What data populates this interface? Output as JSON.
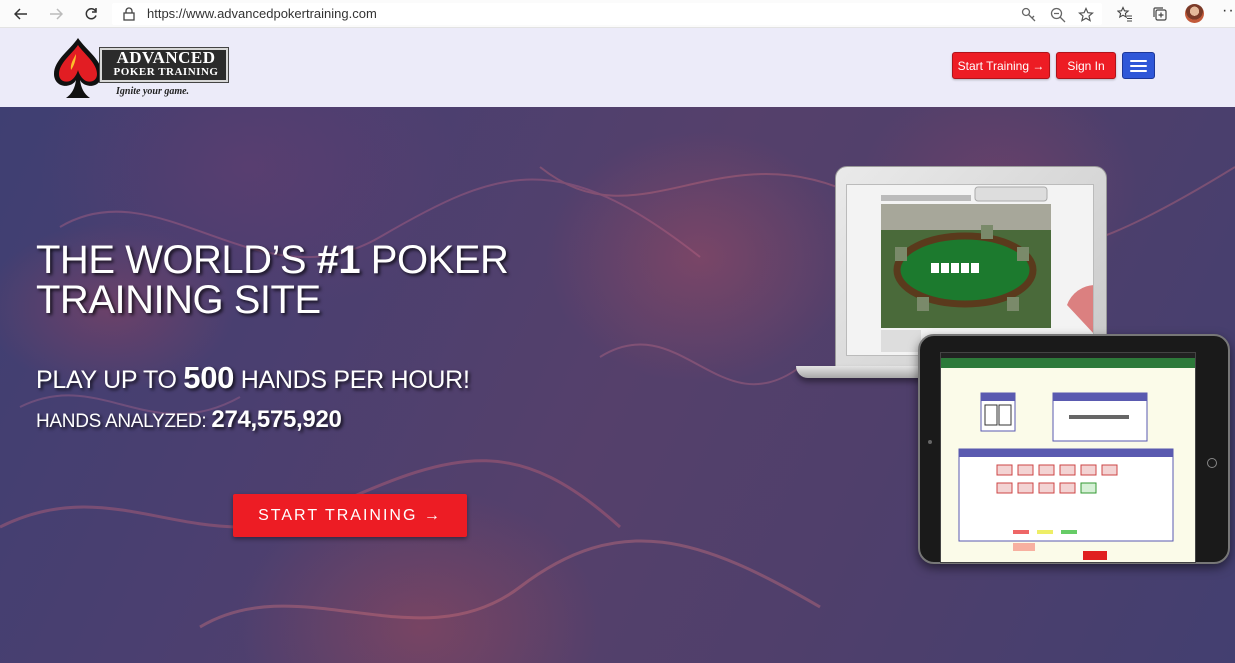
{
  "browser": {
    "url": "https://www.advancedpokertraining.com",
    "icons": [
      "back-icon",
      "forward-icon",
      "refresh-icon",
      "lock-icon",
      "key-icon",
      "zoom-icon",
      "star-icon",
      "favorites-icon",
      "collections-icon",
      "profile-avatar",
      "more-icon"
    ]
  },
  "header": {
    "logo_line1": "ADVANCED",
    "logo_line2": "POKER TRAINING",
    "logo_tagline": "Ignite your game.",
    "start_training_label": "Start Training →",
    "sign_in_label": "Sign In",
    "menu_icon": "hamburger-icon"
  },
  "hero": {
    "headline_a": "THE WORLD’S ",
    "headline_b": "#1",
    "headline_c": " POKER",
    "headline_d": "TRAINING SITE",
    "sub1_a": "PLAY UP TO ",
    "sub1_b": "500",
    "sub1_c": " HANDS PER HOUR!",
    "sub2_a": "HANDS ANALYZED: ",
    "sub2_b": "274,575,920",
    "cta_label": "START TRAINING →"
  },
  "colors": {
    "accent_red": "#ed1c24",
    "menu_blue": "#2f57d8",
    "header_bg": "#ecebf9"
  }
}
